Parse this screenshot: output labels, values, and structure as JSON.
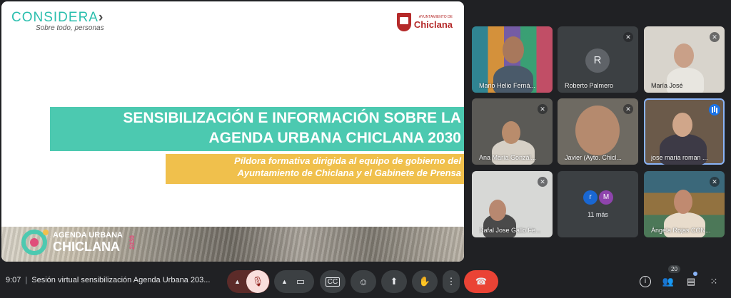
{
  "slide": {
    "brand_name": "CONSIDERA",
    "brand_tagline": "Sobre todo, personas",
    "city_logo_small": "AYUNTAMIENTO DE",
    "city_logo_name": "Chiclana",
    "title_line1": "SENSIBILIZACIÓN E INFORMACIÓN SOBRE LA",
    "title_line2": "AGENDA URBANA CHICLANA 2030",
    "subtitle_line1": "Píldora formativa dirigida al equipo de gobierno del",
    "subtitle_line2": "Ayuntamiento de Chiclana y el Gabinete de Prensa",
    "agenda_word1": "AGENDA URBANA",
    "agenda_word2": "CHICLANA",
    "agenda_year": "2030"
  },
  "participants": [
    {
      "name": "Mario Helio Ferná...",
      "muted": false
    },
    {
      "name": "Roberto Palmero",
      "initial": "R",
      "muted": true
    },
    {
      "name": "María José",
      "muted": true
    },
    {
      "name": "Ana María Gonzál...",
      "muted": true
    },
    {
      "name": "Javier (Ayto. Chicl...",
      "muted": true
    },
    {
      "name": "jose maria roman ...",
      "speaking": true
    },
    {
      "name": "Rafal Jose Gallo Fe...",
      "muted": true
    },
    {
      "more_initial_1": "r",
      "more_initial_2": "M",
      "more_label": "11 más"
    },
    {
      "name": "Ángela Rojas CON...",
      "muted": true
    }
  ],
  "bottom_bar": {
    "time": "9:07",
    "meeting_title": "Sesión virtual sensibilización Agenda Urbana 203...",
    "participant_count": "20"
  },
  "icons": {
    "mic_off": "mic-off-icon",
    "camera": "camera-icon",
    "captions": "captions-icon",
    "emoji": "emoji-icon",
    "present": "present-icon",
    "raise_hand": "raise-hand-icon",
    "more": "more-options-icon",
    "hang_up": "hang-up-icon",
    "info": "info-icon",
    "people": "people-icon",
    "chat": "chat-icon",
    "activities": "activities-icon"
  },
  "colors": {
    "teal": "#4cc9b0",
    "yellow": "#f0c04c",
    "hangup_red": "#ea4335",
    "meet_bg": "#202124",
    "tile_bg": "#3c4043"
  }
}
